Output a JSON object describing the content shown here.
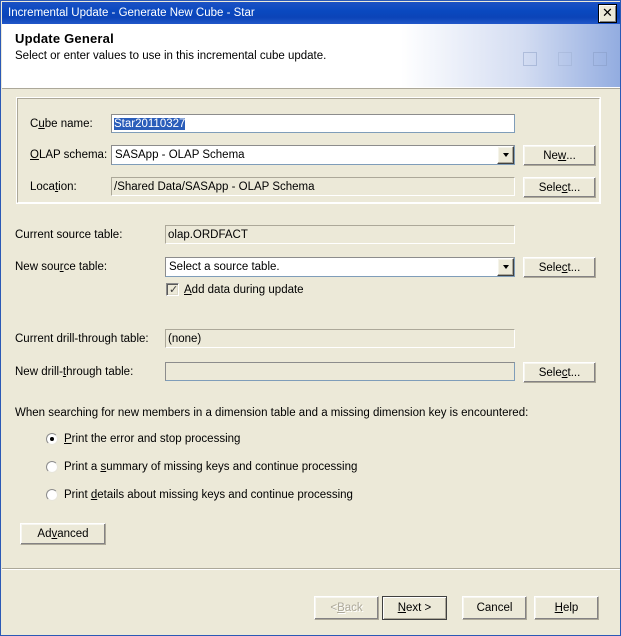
{
  "window": {
    "title": "Incremental Update - Generate New Cube - Star",
    "close_icon": "close-icon",
    "close_glyph": "✕"
  },
  "header": {
    "title": "Update General",
    "subtitle": "Select or enter values to use in this incremental cube update."
  },
  "group_general": {
    "cube_name": {
      "label_pre": "C",
      "label_mnemonic": "u",
      "label_post": "be name:",
      "value": "Star20110327",
      "selected": true
    },
    "olap_schema": {
      "label_pre": "",
      "label_mnemonic": "O",
      "label_post": "LAP schema:",
      "value": "SASApp - OLAP Schema",
      "button": {
        "pre": "Ne",
        "mnemonic": "w",
        "post": "..."
      }
    },
    "location": {
      "label_pre": "Loca",
      "label_mnemonic": "t",
      "label_post": "ion:",
      "value": "/Shared Data/SASApp - OLAP Schema",
      "button": {
        "pre": "Sele",
        "mnemonic": "c",
        "post": "t..."
      }
    }
  },
  "source_tables": {
    "current": {
      "label": "Current source table:",
      "value": "olap.ORDFACT"
    },
    "new": {
      "label_pre": "New sou",
      "label_mnemonic": "r",
      "label_post": "ce table:",
      "value": "Select a source table.",
      "button": {
        "pre": "Sele",
        "mnemonic": "c",
        "post": "t..."
      }
    },
    "add_data_checkbox": {
      "checked": true,
      "tick": "✓",
      "label_pre": "",
      "label_mnemonic": "A",
      "label_post": "dd data during update"
    }
  },
  "drillthrough": {
    "current": {
      "label": "Current drill-through table:",
      "value": "(none)"
    },
    "new": {
      "label_pre": "New drill-",
      "label_mnemonic": "t",
      "label_post": "hrough table:",
      "value": "",
      "button": {
        "pre": "Sele",
        "mnemonic": "c",
        "post": "t..."
      }
    }
  },
  "missing_keys": {
    "prompt": "When searching for new members in a dimension table and a missing dimension key is encountered:",
    "options": [
      {
        "pre": "",
        "mnemonic": "P",
        "post": "rint the error and stop processing",
        "checked": true
      },
      {
        "pre": "Print a ",
        "mnemonic": "s",
        "post": "ummary of missing keys and continue processing",
        "checked": false
      },
      {
        "pre": "Print ",
        "mnemonic": "d",
        "post": "etails about missing keys and continue processing",
        "checked": false
      }
    ]
  },
  "advanced_button": {
    "pre": "Ad",
    "mnemonic": "v",
    "post": "anced"
  },
  "footer": {
    "back": {
      "pre": "< ",
      "mnemonic": "B",
      "post": "ack",
      "disabled": true
    },
    "next": {
      "pre": "",
      "mnemonic": "N",
      "post": "ext >",
      "default": true
    },
    "cancel": {
      "pre": "Cancel",
      "mnemonic": "",
      "post": ""
    },
    "help": {
      "pre": "",
      "mnemonic": "H",
      "post": "elp"
    }
  },
  "colors": {
    "titlebar": "#0a49c0",
    "dialog_face": "#ece9d8",
    "selection": "#2a5dba",
    "border": "#aca899"
  }
}
